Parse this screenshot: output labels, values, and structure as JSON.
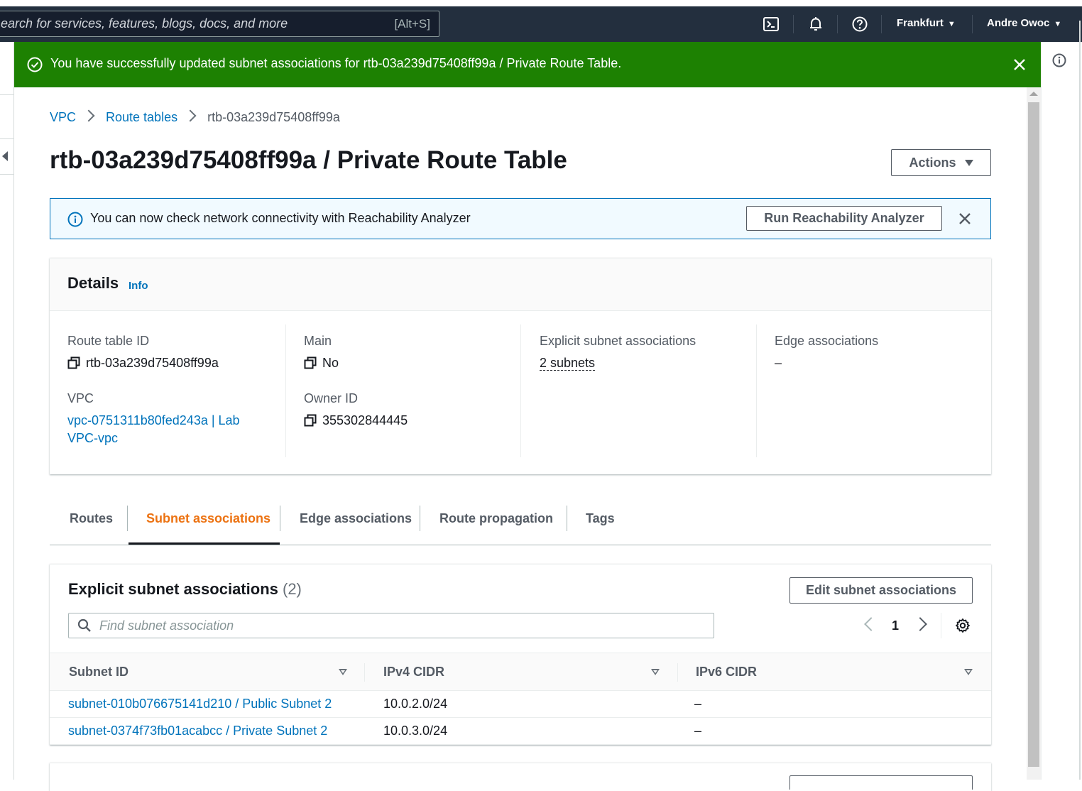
{
  "topnav": {
    "search_placeholder": "earch for services, features, blogs, docs, and more",
    "search_shortcut": "[Alt+S]",
    "region": "Frankfurt",
    "user": "Andre Owoc"
  },
  "flash": {
    "message": "You have successfully updated subnet associations for rtb-03a239d75408ff99a / Private Route Table."
  },
  "breadcrumb": {
    "items": [
      "VPC",
      "Route tables"
    ],
    "current": "rtb-03a239d75408ff99a"
  },
  "page": {
    "title": "rtb-03a239d75408ff99a / Private Route Table",
    "actions_label": "Actions"
  },
  "infobar": {
    "text": "You can now check network connectivity with Reachability Analyzer",
    "button": "Run Reachability Analyzer"
  },
  "details": {
    "heading": "Details",
    "info_link": "Info",
    "route_table_id_label": "Route table ID",
    "route_table_id": "rtb-03a239d75408ff99a",
    "vpc_label": "VPC",
    "vpc_value_line1": "vpc-0751311b80fed243a | Lab",
    "vpc_value_line2": "VPC-vpc",
    "main_label": "Main",
    "main_value": "No",
    "owner_label": "Owner ID",
    "owner_value": "355302844445",
    "explicit_label": "Explicit subnet associations",
    "explicit_value": "2 subnets",
    "edge_label": "Edge associations",
    "edge_value": "–"
  },
  "tabs": [
    "Routes",
    "Subnet associations",
    "Edge associations",
    "Route propagation",
    "Tags"
  ],
  "subnets_panel": {
    "heading": "Explicit subnet associations",
    "count": "(2)",
    "edit_button": "Edit subnet associations",
    "search_placeholder": "Find subnet association",
    "page": "1",
    "columns": [
      "Subnet ID",
      "IPv4 CIDR",
      "IPv6 CIDR"
    ],
    "rows": [
      {
        "subnet": "subnet-010b076675141d210 / Public Subnet 2",
        "ipv4": "10.0.2.0/24",
        "ipv6": "–"
      },
      {
        "subnet": "subnet-0374f73fb01acabcc / Private Subnet 2",
        "ipv4": "10.0.3.0/24",
        "ipv6": "–"
      }
    ]
  },
  "colors": {
    "nav_bg": "#232f3e",
    "success": "#1d8102",
    "link": "#0073bb",
    "active_tab": "#ec7211",
    "info_bg": "#f1faff"
  }
}
